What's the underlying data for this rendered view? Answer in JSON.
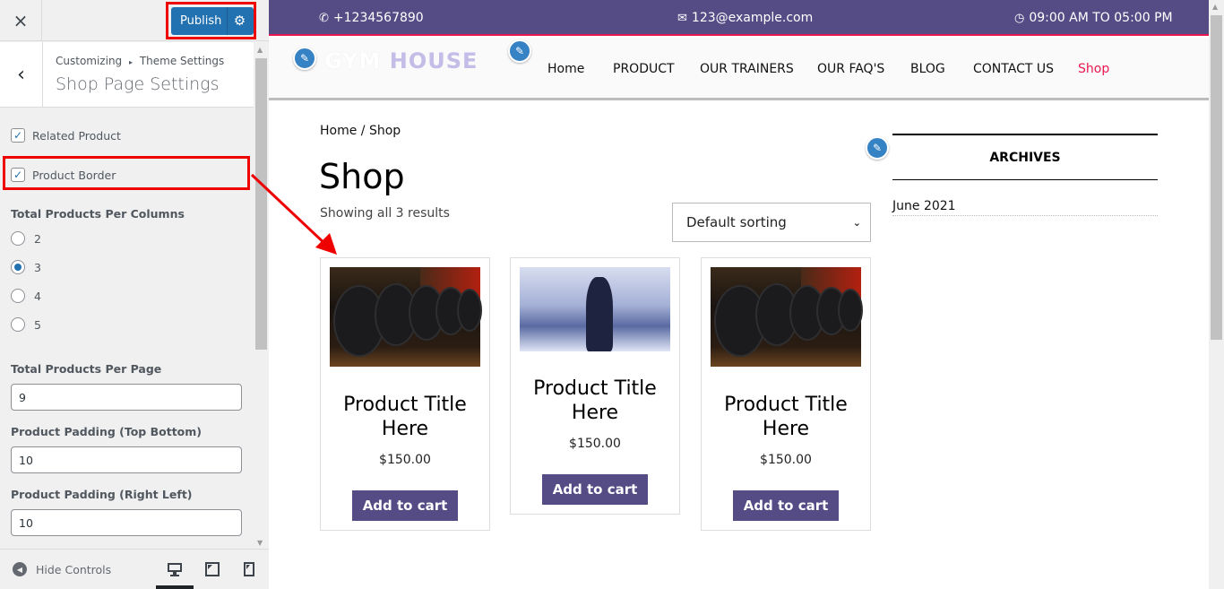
{
  "sidebar": {
    "close_icon": "×",
    "publish_label": "Publish",
    "breadcrumb": {
      "root": "Customizing",
      "separator": "▸",
      "parent": "Theme Settings"
    },
    "section_title": "Shop Page Settings",
    "checkboxes": [
      {
        "label": "Related Product",
        "checked": true
      },
      {
        "label": "Product Border",
        "checked": true
      }
    ],
    "columns": {
      "title": "Total Products Per Columns",
      "options": [
        "2",
        "3",
        "4",
        "5"
      ],
      "selected": "3"
    },
    "per_page": {
      "label": "Total Products Per Page",
      "value": "9"
    },
    "padding_tb": {
      "label": "Product Padding (Top Bottom)",
      "value": "10"
    },
    "padding_rl": {
      "label": "Product Padding (Right Left)",
      "value": "10"
    },
    "footer": {
      "hide_controls": "Hide Controls",
      "devices": [
        "desktop",
        "tablet",
        "mobile"
      ],
      "active_device": "desktop"
    }
  },
  "preview": {
    "info_bar": {
      "phone": "+1234567890",
      "email": "123@example.com",
      "hours": "09:00 AM TO 05:00 PM"
    },
    "logo": {
      "part1": "GYM",
      "part2": "HOUSE"
    },
    "nav": [
      "Home",
      "PRODUCT",
      "OUR TRAINERS",
      "OUR FAQ'S",
      "BLOG",
      "CONTACT US",
      "Shop"
    ],
    "nav_active": "Shop",
    "breadcrumb": "Home / Shop",
    "page_title": "Shop",
    "result_count": "Showing all 3 results",
    "sorting": "Default sorting",
    "products": [
      {
        "title": "Product Title Here",
        "price": "$150.00",
        "button": "Add to cart",
        "image": "dumbbells"
      },
      {
        "title": "Product Title Here",
        "price": "$150.00",
        "button": "Add to cart",
        "image": "gym-woman"
      },
      {
        "title": "Product Title Here",
        "price": "$150.00",
        "button": "Add to cart",
        "image": "dumbbells"
      }
    ],
    "widget": {
      "title": "ARCHIVES",
      "items": [
        "June 2021"
      ]
    }
  },
  "colors": {
    "brand": "#554c86",
    "accent": "#e8174f",
    "publish": "#2271b1",
    "highlight": "#ee0000"
  }
}
